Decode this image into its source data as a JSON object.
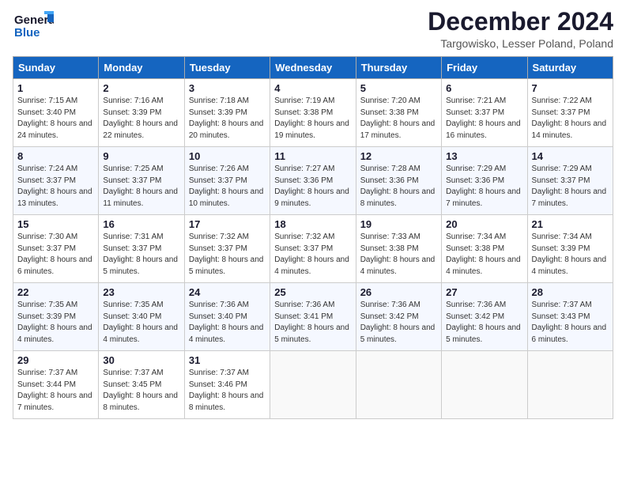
{
  "header": {
    "logo_general": "General",
    "logo_blue": "Blue",
    "month_title": "December 2024",
    "location": "Targowisko, Lesser Poland, Poland"
  },
  "weekdays": [
    "Sunday",
    "Monday",
    "Tuesday",
    "Wednesday",
    "Thursday",
    "Friday",
    "Saturday"
  ],
  "weeks": [
    [
      {
        "day": "1",
        "sunrise": "Sunrise: 7:15 AM",
        "sunset": "Sunset: 3:40 PM",
        "daylight": "Daylight: 8 hours and 24 minutes."
      },
      {
        "day": "2",
        "sunrise": "Sunrise: 7:16 AM",
        "sunset": "Sunset: 3:39 PM",
        "daylight": "Daylight: 8 hours and 22 minutes."
      },
      {
        "day": "3",
        "sunrise": "Sunrise: 7:18 AM",
        "sunset": "Sunset: 3:39 PM",
        "daylight": "Daylight: 8 hours and 20 minutes."
      },
      {
        "day": "4",
        "sunrise": "Sunrise: 7:19 AM",
        "sunset": "Sunset: 3:38 PM",
        "daylight": "Daylight: 8 hours and 19 minutes."
      },
      {
        "day": "5",
        "sunrise": "Sunrise: 7:20 AM",
        "sunset": "Sunset: 3:38 PM",
        "daylight": "Daylight: 8 hours and 17 minutes."
      },
      {
        "day": "6",
        "sunrise": "Sunrise: 7:21 AM",
        "sunset": "Sunset: 3:37 PM",
        "daylight": "Daylight: 8 hours and 16 minutes."
      },
      {
        "day": "7",
        "sunrise": "Sunrise: 7:22 AM",
        "sunset": "Sunset: 3:37 PM",
        "daylight": "Daylight: 8 hours and 14 minutes."
      }
    ],
    [
      {
        "day": "8",
        "sunrise": "Sunrise: 7:24 AM",
        "sunset": "Sunset: 3:37 PM",
        "daylight": "Daylight: 8 hours and 13 minutes."
      },
      {
        "day": "9",
        "sunrise": "Sunrise: 7:25 AM",
        "sunset": "Sunset: 3:37 PM",
        "daylight": "Daylight: 8 hours and 11 minutes."
      },
      {
        "day": "10",
        "sunrise": "Sunrise: 7:26 AM",
        "sunset": "Sunset: 3:37 PM",
        "daylight": "Daylight: 8 hours and 10 minutes."
      },
      {
        "day": "11",
        "sunrise": "Sunrise: 7:27 AM",
        "sunset": "Sunset: 3:36 PM",
        "daylight": "Daylight: 8 hours and 9 minutes."
      },
      {
        "day": "12",
        "sunrise": "Sunrise: 7:28 AM",
        "sunset": "Sunset: 3:36 PM",
        "daylight": "Daylight: 8 hours and 8 minutes."
      },
      {
        "day": "13",
        "sunrise": "Sunrise: 7:29 AM",
        "sunset": "Sunset: 3:36 PM",
        "daylight": "Daylight: 8 hours and 7 minutes."
      },
      {
        "day": "14",
        "sunrise": "Sunrise: 7:29 AM",
        "sunset": "Sunset: 3:37 PM",
        "daylight": "Daylight: 8 hours and 7 minutes."
      }
    ],
    [
      {
        "day": "15",
        "sunrise": "Sunrise: 7:30 AM",
        "sunset": "Sunset: 3:37 PM",
        "daylight": "Daylight: 8 hours and 6 minutes."
      },
      {
        "day": "16",
        "sunrise": "Sunrise: 7:31 AM",
        "sunset": "Sunset: 3:37 PM",
        "daylight": "Daylight: 8 hours and 5 minutes."
      },
      {
        "day": "17",
        "sunrise": "Sunrise: 7:32 AM",
        "sunset": "Sunset: 3:37 PM",
        "daylight": "Daylight: 8 hours and 5 minutes."
      },
      {
        "day": "18",
        "sunrise": "Sunrise: 7:32 AM",
        "sunset": "Sunset: 3:37 PM",
        "daylight": "Daylight: 8 hours and 4 minutes."
      },
      {
        "day": "19",
        "sunrise": "Sunrise: 7:33 AM",
        "sunset": "Sunset: 3:38 PM",
        "daylight": "Daylight: 8 hours and 4 minutes."
      },
      {
        "day": "20",
        "sunrise": "Sunrise: 7:34 AM",
        "sunset": "Sunset: 3:38 PM",
        "daylight": "Daylight: 8 hours and 4 minutes."
      },
      {
        "day": "21",
        "sunrise": "Sunrise: 7:34 AM",
        "sunset": "Sunset: 3:39 PM",
        "daylight": "Daylight: 8 hours and 4 minutes."
      }
    ],
    [
      {
        "day": "22",
        "sunrise": "Sunrise: 7:35 AM",
        "sunset": "Sunset: 3:39 PM",
        "daylight": "Daylight: 8 hours and 4 minutes."
      },
      {
        "day": "23",
        "sunrise": "Sunrise: 7:35 AM",
        "sunset": "Sunset: 3:40 PM",
        "daylight": "Daylight: 8 hours and 4 minutes."
      },
      {
        "day": "24",
        "sunrise": "Sunrise: 7:36 AM",
        "sunset": "Sunset: 3:40 PM",
        "daylight": "Daylight: 8 hours and 4 minutes."
      },
      {
        "day": "25",
        "sunrise": "Sunrise: 7:36 AM",
        "sunset": "Sunset: 3:41 PM",
        "daylight": "Daylight: 8 hours and 5 minutes."
      },
      {
        "day": "26",
        "sunrise": "Sunrise: 7:36 AM",
        "sunset": "Sunset: 3:42 PM",
        "daylight": "Daylight: 8 hours and 5 minutes."
      },
      {
        "day": "27",
        "sunrise": "Sunrise: 7:36 AM",
        "sunset": "Sunset: 3:42 PM",
        "daylight": "Daylight: 8 hours and 5 minutes."
      },
      {
        "day": "28",
        "sunrise": "Sunrise: 7:37 AM",
        "sunset": "Sunset: 3:43 PM",
        "daylight": "Daylight: 8 hours and 6 minutes."
      }
    ],
    [
      {
        "day": "29",
        "sunrise": "Sunrise: 7:37 AM",
        "sunset": "Sunset: 3:44 PM",
        "daylight": "Daylight: 8 hours and 7 minutes."
      },
      {
        "day": "30",
        "sunrise": "Sunrise: 7:37 AM",
        "sunset": "Sunset: 3:45 PM",
        "daylight": "Daylight: 8 hours and 8 minutes."
      },
      {
        "day": "31",
        "sunrise": "Sunrise: 7:37 AM",
        "sunset": "Sunset: 3:46 PM",
        "daylight": "Daylight: 8 hours and 8 minutes."
      },
      null,
      null,
      null,
      null
    ]
  ]
}
